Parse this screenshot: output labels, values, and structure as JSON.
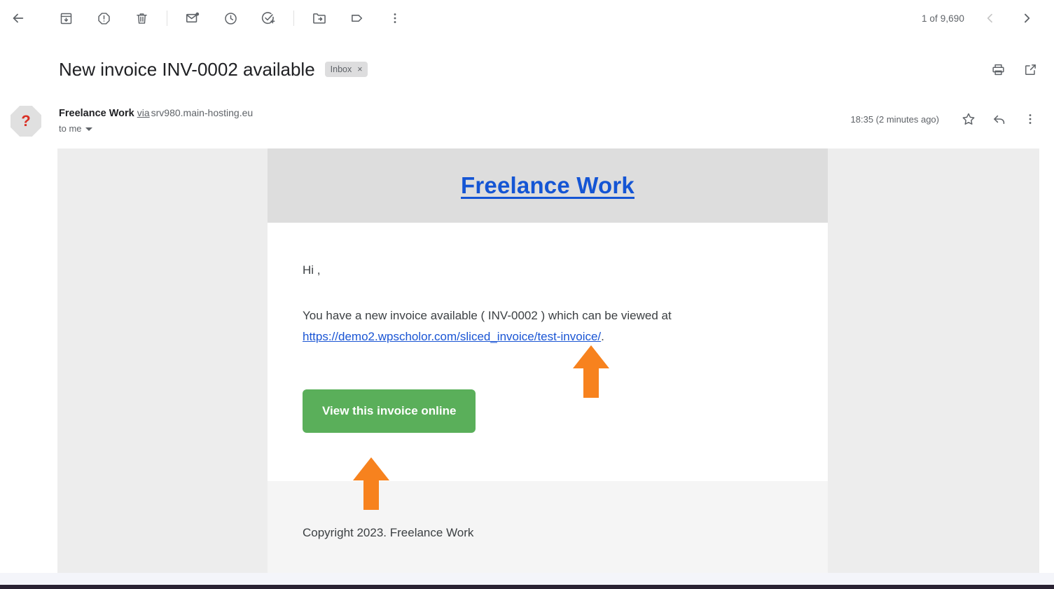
{
  "toolbar": {
    "back": {
      "label": "Back",
      "icon": "arrow-back-icon"
    },
    "archive": {
      "label": "Archive",
      "icon": "archive-icon"
    },
    "report_spam": {
      "label": "Report spam",
      "icon": "report-spam-icon"
    },
    "delete": {
      "label": "Delete",
      "icon": "trash-icon"
    },
    "mark_unread": {
      "label": "Mark as unread",
      "icon": "mark-unread-icon"
    },
    "snooze": {
      "label": "Snooze",
      "icon": "clock-icon"
    },
    "add_to_tasks": {
      "label": "Add to tasks",
      "icon": "add-task-icon"
    },
    "move_to": {
      "label": "Move to",
      "icon": "move-to-folder-icon"
    },
    "labels": {
      "label": "Labels",
      "icon": "label-tag-icon"
    },
    "more": {
      "label": "More",
      "icon": "more-vert-icon"
    },
    "counter": "1 of 9,690",
    "prev": {
      "label": "Older",
      "icon": "chevron-left-icon"
    },
    "next": {
      "label": "Newer",
      "icon": "chevron-right-icon"
    }
  },
  "subject": {
    "title": "New invoice INV-0002 available",
    "chip_label": "Inbox",
    "chip_close": "×",
    "print_icon": "print-icon",
    "popout_icon": "open-in-new-icon"
  },
  "sender": {
    "avatar_glyph": "?",
    "name": "Freelance Work",
    "via": "via",
    "host": "srv980.main-hosting.eu",
    "to": "to me",
    "time": "18:35 (2 minutes ago)",
    "star_icon": "star-icon",
    "reply_icon": "reply-icon",
    "more_icon": "more-vert-icon"
  },
  "email": {
    "brand": "Freelance Work",
    "greeting": "Hi ,",
    "body_before_link": "You have a new invoice available ( INV-0002 ) which can be viewed at ",
    "link_text": "https://demo2.wpscholor.com/sliced_invoice/test-invoice/",
    "body_after_link": ".",
    "cta_label": "View this invoice online",
    "copyright": "Copyright 2023. Freelance Work"
  },
  "annotations": {
    "arrow_link": {
      "name": "arrow-pointing-to-invoice-link",
      "color": "#f7821e"
    },
    "arrow_button": {
      "name": "arrow-pointing-to-view-invoice-button",
      "color": "#f7821e"
    }
  },
  "colors": {
    "brand_link": "#1455d4",
    "cta_green": "#5aaf5a",
    "annotation_orange": "#f7821e",
    "header_band": "#dddddd",
    "page_gray": "#ededed",
    "footer_gray": "#f5f5f5"
  }
}
